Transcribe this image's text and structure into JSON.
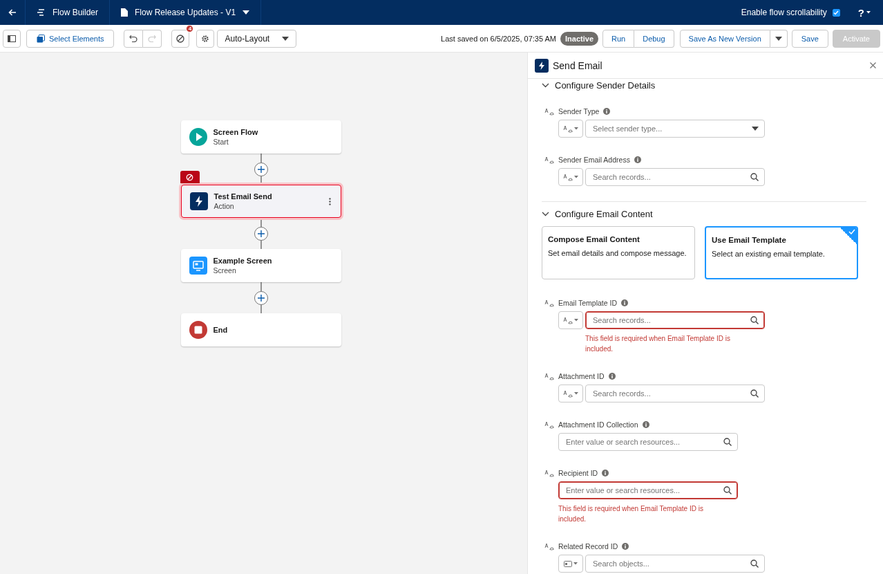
{
  "header": {
    "app": "Flow Builder",
    "flow_name": "Flow Release Updates - V1",
    "scroll_toggle": {
      "label": "Enable flow scrollability",
      "checked": true
    },
    "help": "?"
  },
  "toolbar": {
    "select_elements": "Select Elements",
    "undo_disabled": false,
    "redo_disabled": true,
    "error_count": "4",
    "layout": "Auto-Layout",
    "last_saved": "Last saved on 6/5/2025, 07:35 AM",
    "status": "Inactive",
    "buttons": [
      {
        "label": "Run",
        "kind": "group"
      },
      {
        "label": "Debug",
        "kind": "group"
      },
      {
        "label": "Save As New Version",
        "kind": "split"
      },
      {
        "label": "Save",
        "kind": "plain"
      },
      {
        "label": "Activate",
        "kind": "disabled"
      }
    ]
  },
  "nodes": [
    {
      "kind": "start",
      "title": "Screen Flow",
      "subtitle": "Start",
      "selected": false,
      "error": false
    },
    {
      "kind": "action",
      "title": "Test Email Send",
      "subtitle": "Action",
      "selected": true,
      "error": true
    },
    {
      "kind": "screen",
      "title": "Example Screen",
      "subtitle": "Screen",
      "selected": false,
      "error": false
    },
    {
      "kind": "end",
      "title": "End",
      "selected": false,
      "error": false
    }
  ],
  "panel": {
    "title": "Send Email",
    "sections": [
      {
        "title": "Configure Sender Details",
        "expanded": true,
        "fields": [
          {
            "label": "Sender Type",
            "kind": "select",
            "picker": {
              "kind": "text"
            },
            "placeholder": "Select sender type..."
          },
          {
            "label": "Sender Email Address",
            "kind": "search",
            "picker": {
              "kind": "text"
            },
            "placeholder": "Search records..."
          }
        ]
      },
      {
        "title": "Configure Email Content",
        "expanded": true,
        "options": [
          {
            "title": "Compose Email Content",
            "description": "Set email details and compose message.",
            "selected": false
          },
          {
            "title": "Use Email Template",
            "description": "Select an existing email template.",
            "selected": true
          }
        ],
        "fields": [
          {
            "label": "Email Template ID",
            "kind": "search",
            "picker": {
              "kind": "text"
            },
            "placeholder": "Search records...",
            "error": "This field is required when Email Template ID is included."
          },
          {
            "label": "Attachment ID",
            "kind": "search",
            "picker": {
              "kind": "text"
            },
            "placeholder": "Search records..."
          },
          {
            "label": "Attachment ID Collection",
            "kind": "resource",
            "placeholder": "Enter value or search resources..."
          },
          {
            "label": "Recipient ID",
            "kind": "resource",
            "placeholder": "Enter value or search resources...",
            "error": "This field is required when Email Template ID is included."
          },
          {
            "label": "Related Record ID",
            "kind": "search",
            "picker": {
              "kind": "object"
            },
            "placeholder": "Search objects..."
          }
        ]
      }
    ]
  }
}
